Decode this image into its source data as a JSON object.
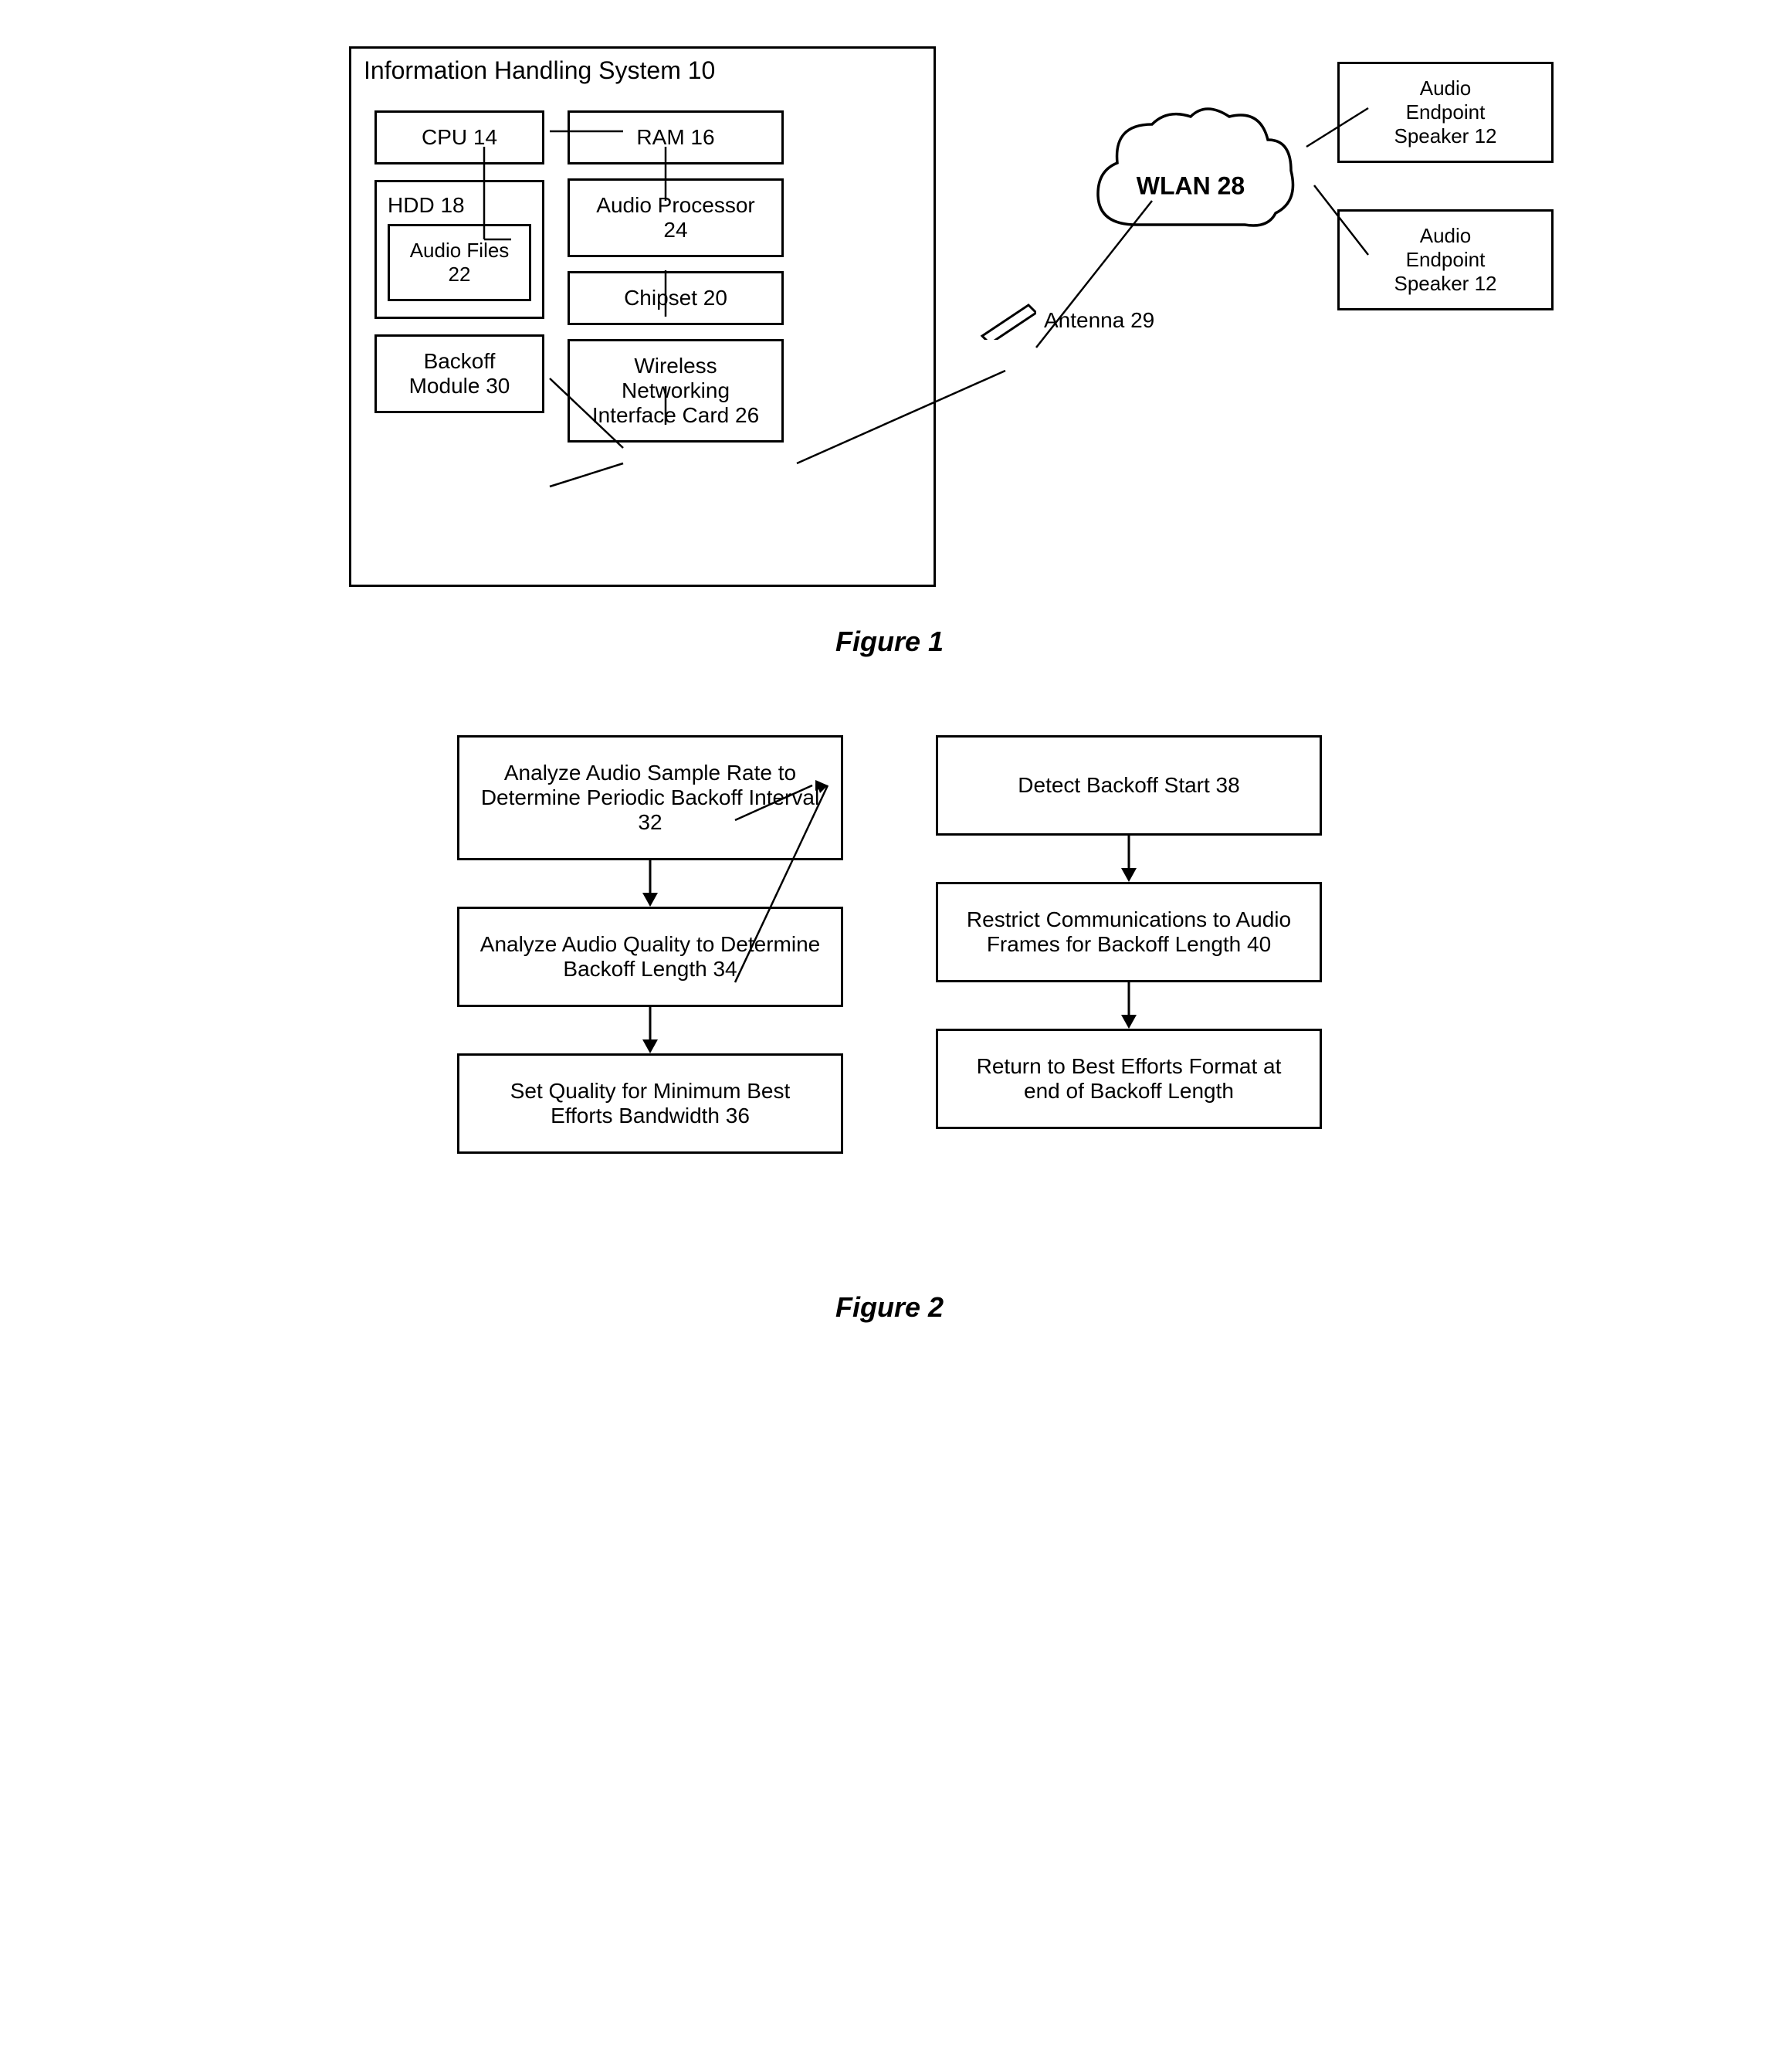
{
  "figure1": {
    "caption": "Figure 1",
    "ihs": {
      "title": "Information Handling System 10",
      "cpu": "CPU 14",
      "ram": "RAM 16",
      "hdd": "HDD 18",
      "audio_files": "Audio Files 22",
      "audio_processor": "Audio Processor 24",
      "chipset": "Chipset 20",
      "wireless_card": "Wireless Networking Interface Card 26",
      "backoff_module": "Backoff Module 30"
    },
    "wlan": "WLAN 28",
    "antenna": "Antenna 29",
    "audio_endpoint_1": {
      "line1": "Audio",
      "line2": "Endpoint",
      "line3": "Speaker 12"
    },
    "audio_endpoint_2": {
      "line1": "Audio",
      "line2": "Endpoint",
      "line3": "Speaker 12"
    }
  },
  "figure2": {
    "caption": "Figure 2",
    "left_col": [
      "Analyze Audio Sample Rate to Determine Periodic Backoff Interval 32",
      "Analyze Audio Quality to Determine Backoff Length 34",
      "Set Quality for Minimum Best Efforts Bandwidth 36"
    ],
    "right_col": [
      "Detect Backoff Start 38",
      "Restrict Communications to Audio Frames for Backoff Length 40",
      "Return to Best Efforts Format at end of Backoff Length"
    ]
  }
}
